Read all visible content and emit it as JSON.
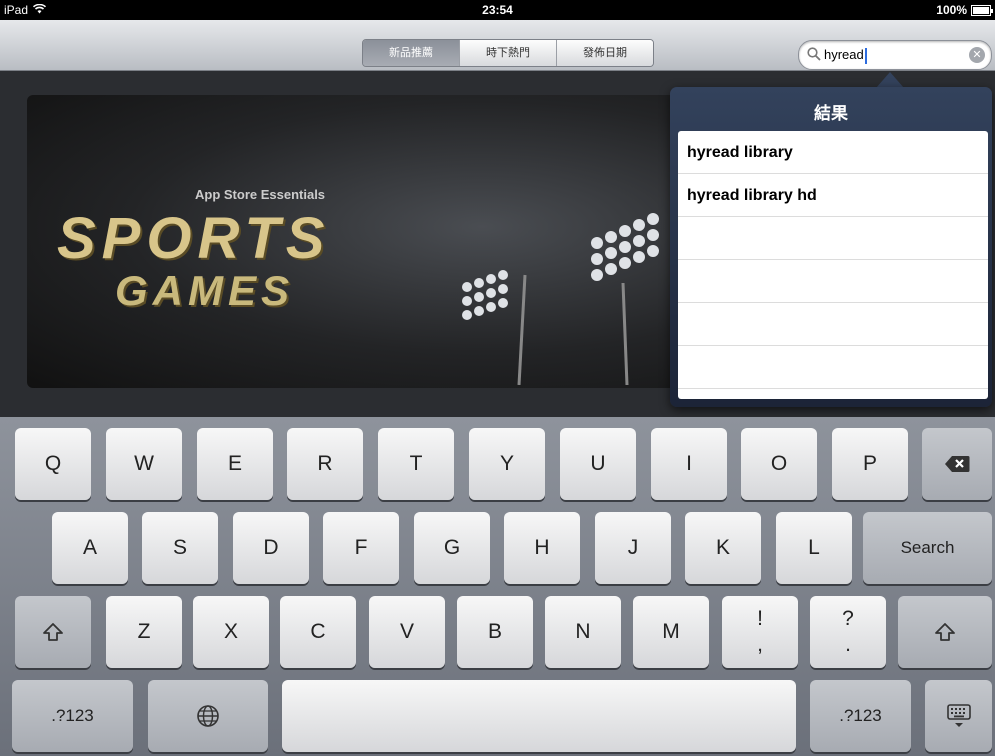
{
  "status_bar": {
    "device": "iPad",
    "time": "23:54",
    "battery": "100%"
  },
  "navbar": {
    "segments": [
      {
        "label": "新品推薦",
        "active": true
      },
      {
        "label": "時下熱門",
        "active": false
      },
      {
        "label": "發佈日期",
        "active": false
      }
    ],
    "search": {
      "value": "hyread"
    }
  },
  "banner": {
    "subtitle": "App Store Essentials",
    "title_line1": "SPORTS",
    "title_line2": "GAMES"
  },
  "popover": {
    "title": "結果",
    "results": [
      "hyread library",
      "hyread library hd",
      "",
      "",
      "",
      ""
    ]
  },
  "keyboard": {
    "row1": [
      "Q",
      "W",
      "E",
      "R",
      "T",
      "Y",
      "U",
      "I",
      "O",
      "P"
    ],
    "row2": [
      "A",
      "S",
      "D",
      "F",
      "G",
      "H",
      "J",
      "K",
      "L"
    ],
    "row3": [
      "Z",
      "X",
      "C",
      "V",
      "B",
      "N",
      "M"
    ],
    "search_label": "Search",
    "exclaim_top": "!",
    "exclaim_bottom": ",",
    "question_top": "?",
    "question_bottom": ".",
    "numbers_label": ".?123"
  }
}
